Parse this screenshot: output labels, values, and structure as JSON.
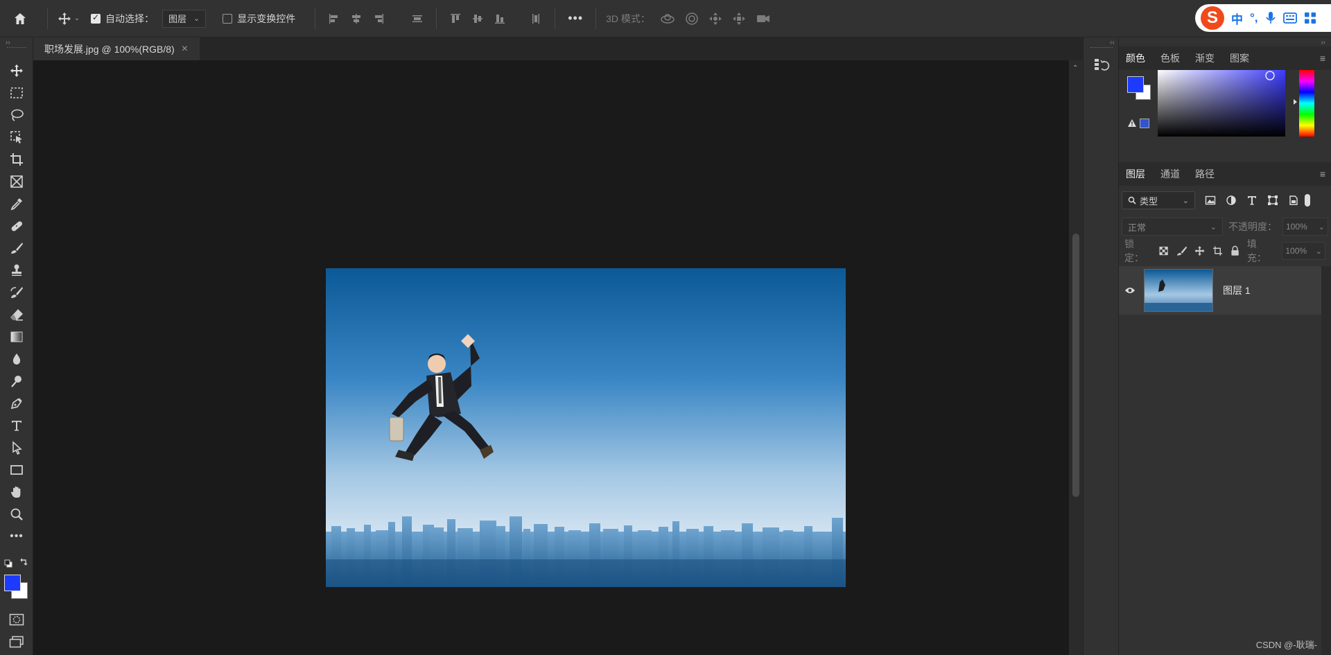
{
  "options_bar": {
    "auto_select_label": "自动选择：",
    "auto_select_checked": true,
    "auto_select_target": "图层",
    "show_transform_label": "显示变换控件",
    "show_transform_checked": false,
    "mode_3d_label": "3D 模式："
  },
  "ime": {
    "logo": "S",
    "lang": "中",
    "punct": "°,",
    "icons": [
      "mic-icon",
      "keyboard-icon",
      "grid-icon"
    ]
  },
  "document_tab": {
    "title": "职场发展.jpg @ 100%(RGB/8)",
    "close": "×"
  },
  "tools": [
    "move",
    "marquee",
    "lasso",
    "object-select",
    "crop",
    "frame",
    "eyedropper",
    "healing",
    "brush",
    "stamp",
    "history-brush",
    "eraser",
    "gradient",
    "blur",
    "dodge",
    "pen",
    "type",
    "path-select",
    "rectangle",
    "hand",
    "zoom",
    "more"
  ],
  "colors": {
    "foreground": "#1d3bff",
    "background": "#ffffff",
    "accent_blue": "#3d3dff"
  },
  "color_panel": {
    "tabs": [
      "颜色",
      "色板",
      "渐变",
      "图案"
    ],
    "active": "颜色"
  },
  "layers_panel": {
    "tabs": [
      "图层",
      "通道",
      "路径"
    ],
    "active": "图层",
    "filter_label": "类型",
    "blend_mode": "正常",
    "opacity_label": "不透明度：",
    "opacity_value": "100%",
    "lock_label": "锁定：",
    "fill_label": "填充：",
    "fill_value": "100%",
    "layers": [
      {
        "name": "图层 1",
        "visible": true
      }
    ]
  },
  "watermark": "CSDN @-耿瑞-"
}
